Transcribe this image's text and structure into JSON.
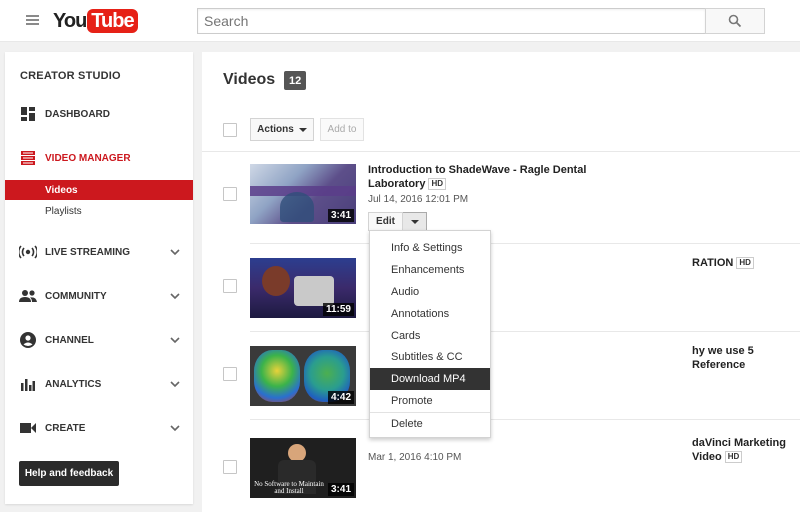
{
  "header": {
    "logo_you": "You",
    "logo_tube": "Tube",
    "search_placeholder": "Search"
  },
  "sidebar": {
    "title": "CREATOR STUDIO",
    "items": [
      {
        "label": "DASHBOARD",
        "icon": "dashboard-icon"
      },
      {
        "label": "VIDEO MANAGER",
        "icon": "video-manager-icon",
        "active": true
      },
      {
        "label": "LIVE STREAMING",
        "icon": "live-streaming-icon"
      },
      {
        "label": "COMMUNITY",
        "icon": "community-icon"
      },
      {
        "label": "CHANNEL",
        "icon": "channel-icon"
      },
      {
        "label": "ANALYTICS",
        "icon": "analytics-icon"
      },
      {
        "label": "CREATE",
        "icon": "create-icon"
      }
    ],
    "subitems": [
      {
        "label": "Videos",
        "active": true
      },
      {
        "label": "Playlists"
      }
    ],
    "help_label": "Help and feedback"
  },
  "main": {
    "title": "Videos",
    "count": "12",
    "actions_label": "Actions",
    "addto_label": "Add to",
    "edit_label": "Edit",
    "videos": [
      {
        "title_line1": "Introduction to ShadeWave - Ragle Dental",
        "title_line2": "Laboratory",
        "hd": "HD",
        "date": "Jul 14, 2016 12:01 PM",
        "duration": "3:41"
      },
      {
        "title_visible": "RATION",
        "hd": "HD",
        "duration": "11:59"
      },
      {
        "title_visible": "hy we use 5 Reference",
        "duration": "4:42"
      },
      {
        "title_visible": "daVinci Marketing Video",
        "hd": "HD",
        "date": "Mar 1, 2016 4:10 PM",
        "duration": "3:41",
        "thumb_caption": "No Software to Maintain and Install"
      }
    ],
    "menu": [
      "Info & Settings",
      "Enhancements",
      "Audio",
      "Annotations",
      "Cards",
      "Subtitles & CC",
      "Download MP4",
      "Promote",
      "Delete"
    ],
    "menu_highlighted": "Download MP4"
  },
  "colors": {
    "accent": "#cc181e",
    "logo_red": "#e62117",
    "dark": "#333333"
  }
}
